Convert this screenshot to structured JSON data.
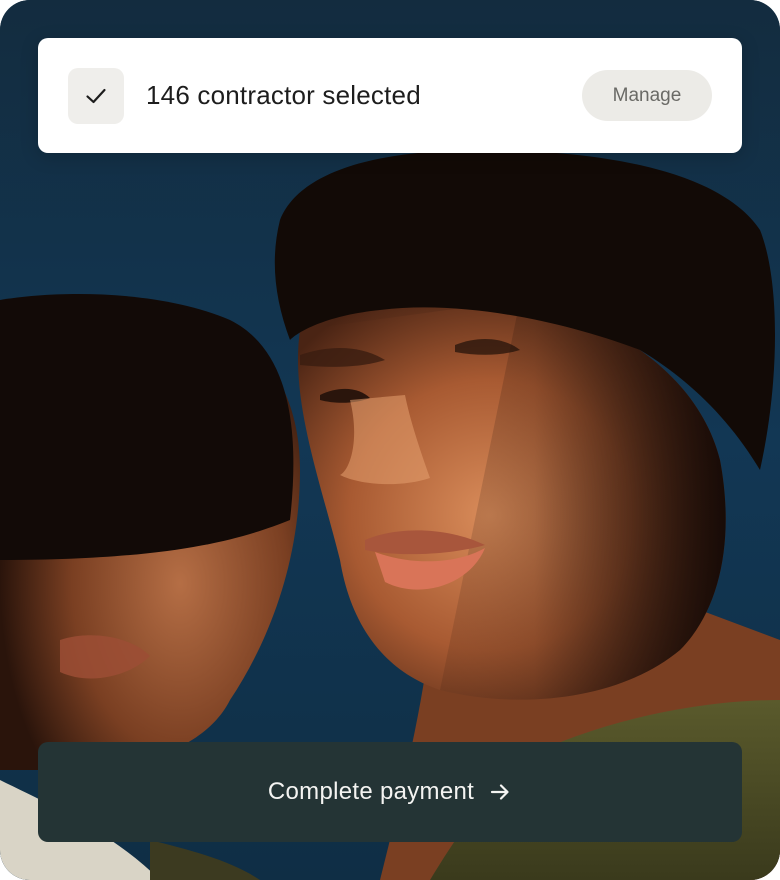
{
  "selection": {
    "count_text": "146 contractor selected",
    "checked": true,
    "manage_label": "Manage"
  },
  "action": {
    "pay_label": "Complete payment",
    "arrow_icon": "arrow-right-icon"
  },
  "colors": {
    "background_blue": "#13324a",
    "button_dark": "#243435",
    "chip_gray": "#ecebe7"
  }
}
